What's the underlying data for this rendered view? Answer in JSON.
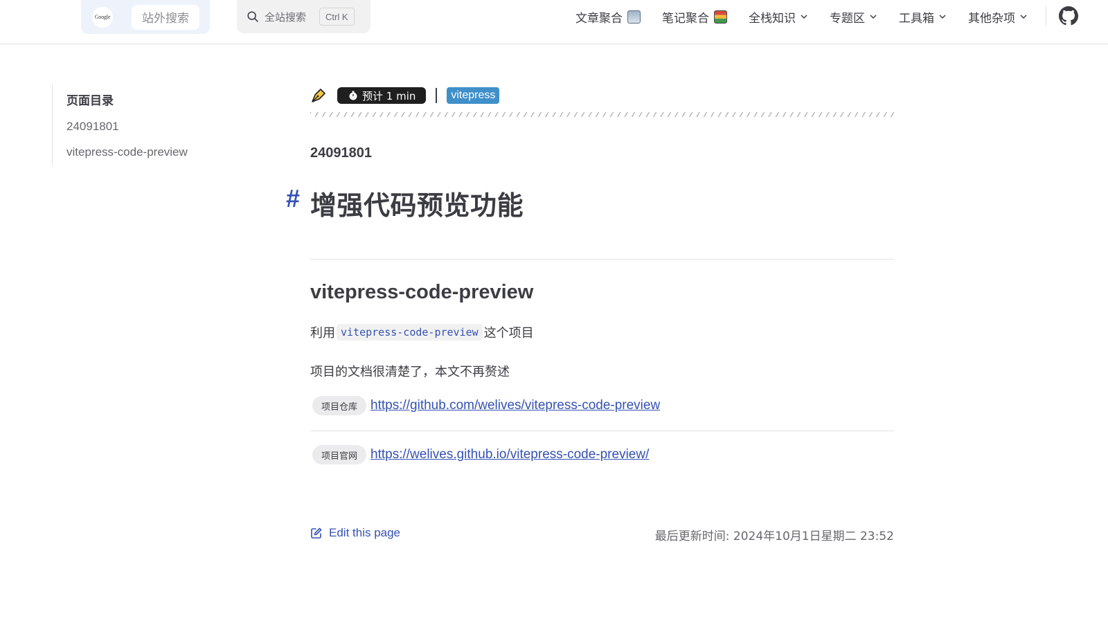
{
  "header": {
    "google_logo_text": "Google",
    "outer_search_label": "站外搜索",
    "site_search_label": "全站搜索",
    "site_search_shortcut": "Ctrl K",
    "nav": [
      {
        "label": "文章聚合",
        "icon": "newspaper-icon",
        "dropdown": false
      },
      {
        "label": "笔记聚合",
        "icon": "books-icon",
        "dropdown": false
      },
      {
        "label": "全栈知识",
        "dropdown": true
      },
      {
        "label": "专题区",
        "dropdown": true
      },
      {
        "label": "工具箱",
        "dropdown": true
      },
      {
        "label": "其他杂项",
        "dropdown": true
      }
    ],
    "github_icon": "github-icon"
  },
  "toc": {
    "title": "页面目录",
    "items": [
      "24091801",
      "vitepress-code-preview"
    ]
  },
  "meta": {
    "reading_time": "预计 1 min",
    "tag": "vitepress"
  },
  "article": {
    "doc_id": "24091801",
    "h1_anchor": "#",
    "h1": "增强代码预览功能",
    "h2": "vitepress-code-preview",
    "p1_before": "利用",
    "p1_code": "vitepress-code-preview",
    "p1_after": "这个项目",
    "p2": "项目的文档很清楚了，本文不再赘述",
    "links": [
      {
        "label": "项目仓库",
        "url": "https://github.com/welives/vitepress-code-preview"
      },
      {
        "label": "项目官网",
        "url": "https://welives.github.io/vitepress-code-preview/"
      }
    ]
  },
  "footer": {
    "edit_label": "Edit this page",
    "last_updated": "最后更新时间: 2024年10月1日星期二 23:52"
  },
  "colors": {
    "brand": "#3451b2",
    "tag_bg": "#3f8fc8",
    "badge_bg": "#1f1f1f"
  }
}
